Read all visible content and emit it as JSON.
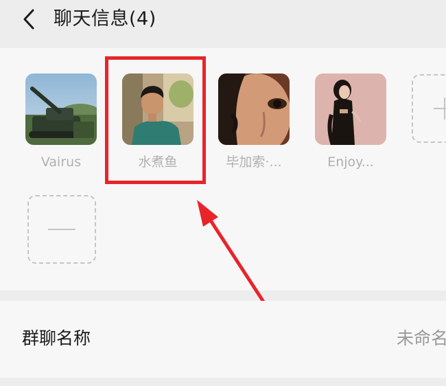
{
  "header": {
    "back_icon": "chevron-left-icon",
    "title": "聊天信息(4)"
  },
  "members": [
    {
      "name": "Vairus"
    },
    {
      "name": "水煮鱼"
    },
    {
      "name": "毕加索·..."
    },
    {
      "name": "Enjoy..."
    }
  ],
  "actions": {
    "add_icon": "plus-icon",
    "remove_icon": "minus-icon"
  },
  "group_name": {
    "label": "群聊名称",
    "value": "未命名"
  },
  "colors": {
    "highlight": "#e8242a",
    "background": "#ededed",
    "card": "#f7f7f7"
  }
}
